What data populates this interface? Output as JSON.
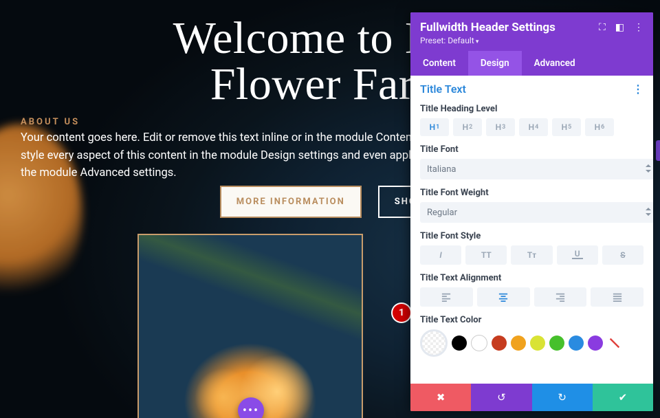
{
  "hero": {
    "title_line1": "Welcome to Divi",
    "title_line2": "Flower Farm",
    "subhead": "ABOUT US",
    "body": "Your content goes here. Edit or remove this text inline or in the module Content settings. You can also style every aspect of this content in the module Design settings and even apply custom CSS to this text in the module Advanced settings.",
    "btn_more": "MORE INFORMATION",
    "btn_shop": "SHOP"
  },
  "badge": "1",
  "panel": {
    "title": "Fullwidth Header Settings",
    "preset": "Preset: Default",
    "tabs": {
      "content": "Content",
      "design": "Design",
      "advanced": "Advanced",
      "active": "design"
    },
    "section": "Title Text",
    "labels": {
      "heading_level": "Title Heading Level",
      "font": "Title Font",
      "font_value": "Italiana",
      "weight": "Title Font Weight",
      "weight_value": "Regular",
      "style": "Title Font Style",
      "alignment": "Title Text Alignment",
      "color": "Title Text Color"
    },
    "heading_levels": [
      "H1",
      "H2",
      "H3",
      "H4",
      "H5",
      "H6"
    ],
    "style_opts": {
      "i": "I",
      "tt": "TT",
      "tt2": "Tᴛ",
      "u": "U",
      "s": "S"
    },
    "colors": [
      "#000000",
      "#ffffff",
      "#c63c1f",
      "#f0a21e",
      "#d9e335",
      "#46c02b",
      "#2a8be0",
      "#8a3be0"
    ]
  }
}
